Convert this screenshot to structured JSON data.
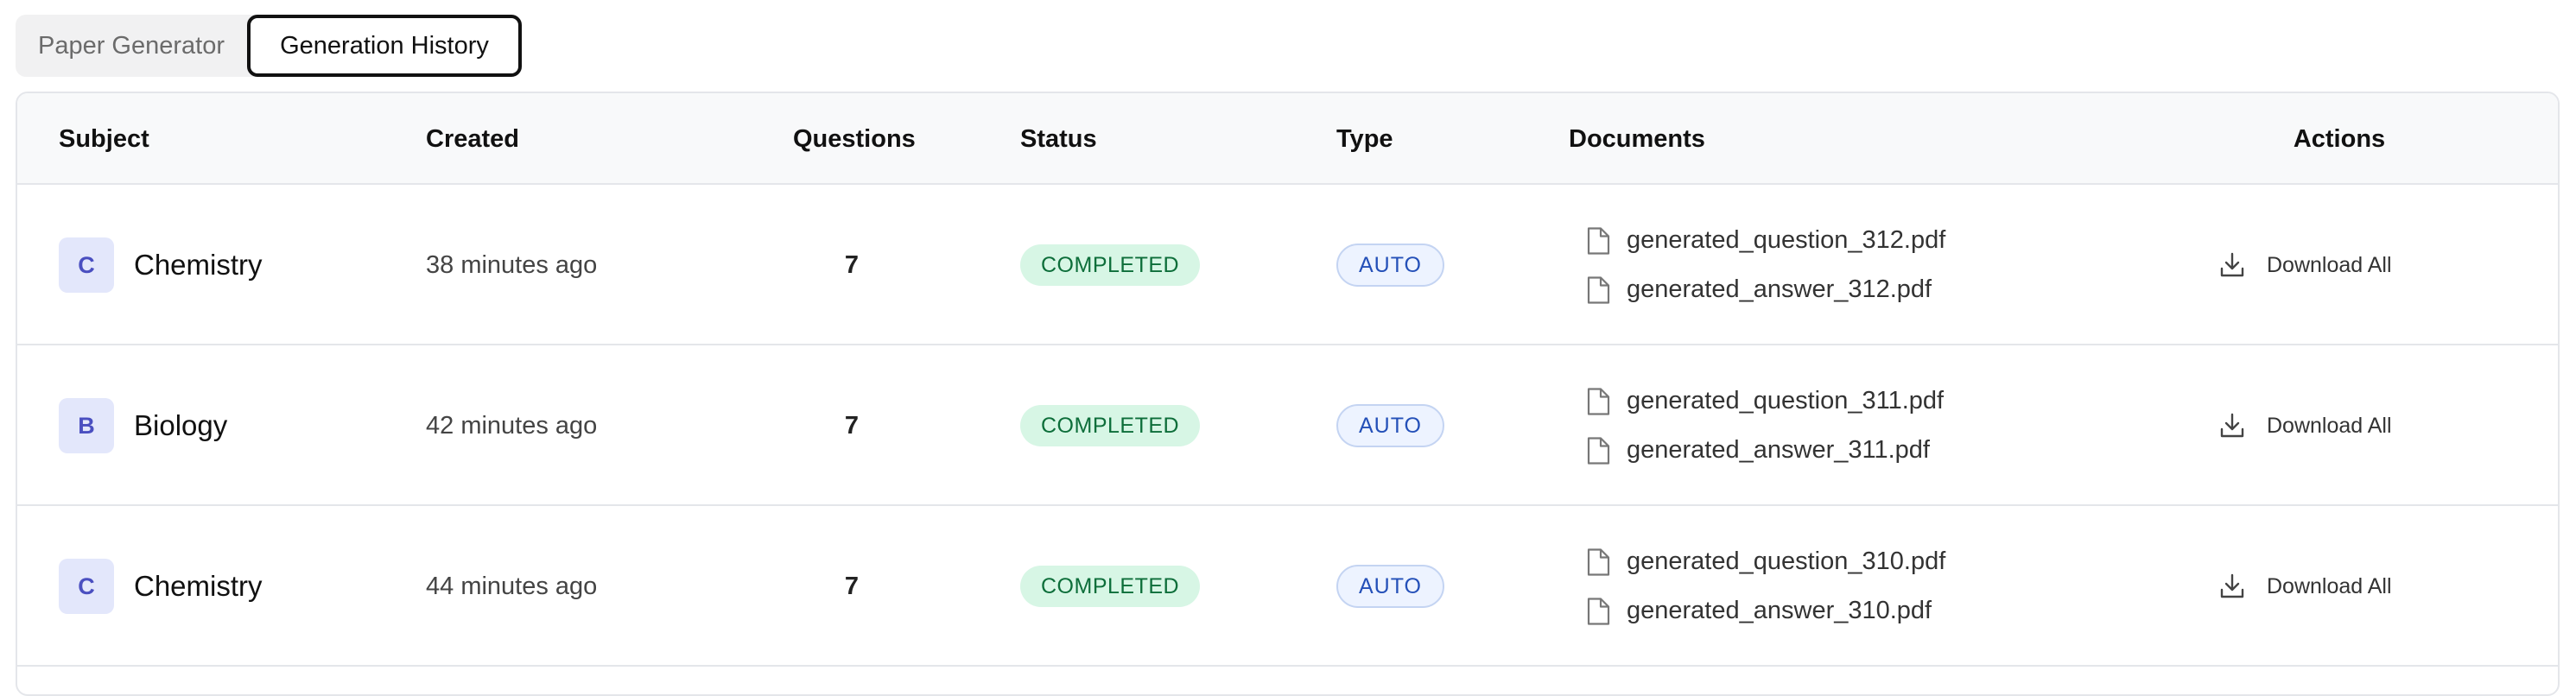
{
  "tabs": [
    {
      "label": "Paper Generator",
      "active": false
    },
    {
      "label": "Generation History",
      "active": true
    }
  ],
  "table": {
    "columns": {
      "subject": "Subject",
      "created": "Created",
      "questions": "Questions",
      "status": "Status",
      "type": "Type",
      "documents": "Documents",
      "actions": "Actions"
    },
    "rows": [
      {
        "avatar": "C",
        "subject": "Chemistry",
        "created": "38 minutes ago",
        "questions": "7",
        "status": "COMPLETED",
        "type": "AUTO",
        "documents": [
          "generated_question_312.pdf",
          "generated_answer_312.pdf"
        ],
        "action": "Download All"
      },
      {
        "avatar": "B",
        "subject": "Biology",
        "created": "42 minutes ago",
        "questions": "7",
        "status": "COMPLETED",
        "type": "AUTO",
        "documents": [
          "generated_question_311.pdf",
          "generated_answer_311.pdf"
        ],
        "action": "Download All"
      },
      {
        "avatar": "C",
        "subject": "Chemistry",
        "created": "44 minutes ago",
        "questions": "7",
        "status": "COMPLETED",
        "type": "AUTO",
        "documents": [
          "generated_question_310.pdf",
          "generated_answer_310.pdf"
        ],
        "action": "Download All"
      }
    ]
  },
  "icons": {
    "document": "file-icon",
    "download": "download-icon"
  },
  "colors": {
    "status_completed_bg": "#d7f6e5",
    "status_completed_text": "#0d6e3a",
    "type_auto_bg": "#edf3ff",
    "type_auto_text": "#2450b8",
    "avatar_bg": "#e3e7fb",
    "avatar_text": "#4a4fc0"
  }
}
